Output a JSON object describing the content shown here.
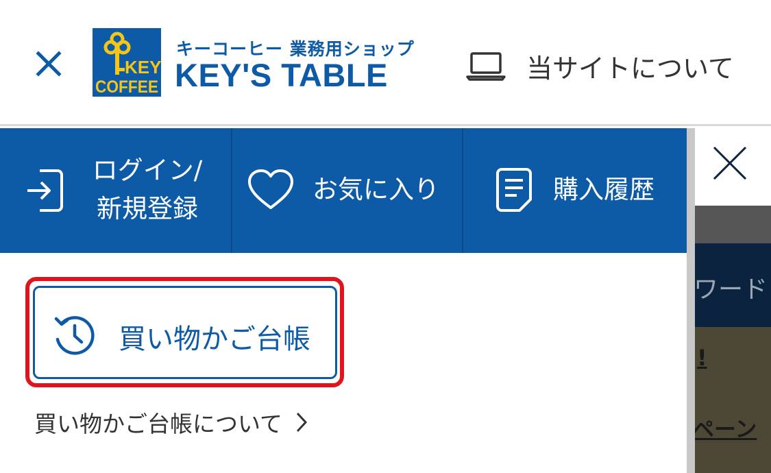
{
  "header": {
    "close_icon": "close-icon",
    "logo": {
      "line1": "KEY",
      "line2": "COFFEE"
    },
    "brand_sub": "キーコーヒー 業務用ショップ",
    "brand_main": "KEY'S TABLE",
    "about": {
      "icon": "laptop-icon",
      "label": "当サイトについて"
    }
  },
  "drawer": {
    "nav": [
      {
        "icon": "login-icon",
        "label": "ログイン/新規登録"
      },
      {
        "icon": "heart-icon",
        "label": "お気に入り"
      },
      {
        "icon": "document-icon",
        "label": "購入履歴"
      }
    ],
    "cart_ledger": {
      "icon": "history-clock-icon",
      "label": "買い物かご台帳"
    },
    "about_cart": {
      "label": "買い物かご台帳について",
      "icon": "chevron-right-icon"
    }
  },
  "background_page": {
    "close_icon": "close-icon",
    "navy_text": "ワード",
    "olive_text1": "!",
    "olive_text2": "ペーン"
  },
  "colors": {
    "brand_blue": "#0d5aa7",
    "highlight_red": "#e0141e",
    "logo_yellow": "#f5c518"
  }
}
